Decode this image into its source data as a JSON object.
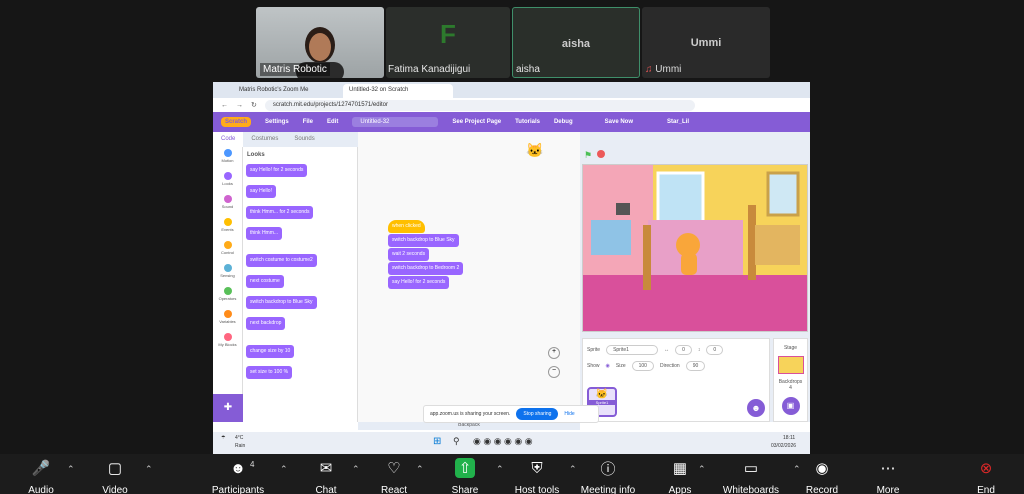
{
  "participants": [
    {
      "name": "Matris Robotic"
    },
    {
      "name": "Fatima Kanadijigui",
      "initial": "F"
    },
    {
      "name": "aisha",
      "label_large": "aisha"
    },
    {
      "name": "Ummi",
      "label_large": "Ummi"
    }
  ],
  "browser": {
    "tabs": [
      "Matris Robotic's Zoom Me",
      "Untitled-32 on Scratch"
    ],
    "url": "scratch.mit.edu/projects/1274701571/editor"
  },
  "scratch": {
    "menu": {
      "settings": "Settings",
      "file": "File",
      "edit": "Edit",
      "project_title": "Untitled-32",
      "see_project": "See Project Page",
      "tutorials": "Tutorials",
      "debug": "Debug",
      "save_now": "Save Now",
      "user": "Star_Lil"
    },
    "tabs": {
      "code": "Code",
      "costumes": "Costumes",
      "sounds": "Sounds"
    },
    "categories": [
      {
        "label": "Motion",
        "color": "#4c97ff"
      },
      {
        "label": "Looks",
        "color": "#9966ff"
      },
      {
        "label": "Sound",
        "color": "#cf63cf"
      },
      {
        "label": "Events",
        "color": "#ffbf00"
      },
      {
        "label": "Control",
        "color": "#ffab19"
      },
      {
        "label": "Sensing",
        "color": "#5cb1d6"
      },
      {
        "label": "Operators",
        "color": "#59c059"
      },
      {
        "label": "Variables",
        "color": "#ff8c1a"
      },
      {
        "label": "My Blocks",
        "color": "#ff6680"
      }
    ],
    "palette_heading": "Looks",
    "palette_blocks": [
      "say Hello! for 2 seconds",
      "say Hello!",
      "think Hmm... for 2 seconds",
      "think Hmm...",
      "switch costume to costume2",
      "next costume",
      "switch backdrop to Blue Sky",
      "next backdrop",
      "change size by 10",
      "set size to 100 %"
    ],
    "script_blocks": [
      "when clicked",
      "switch backdrop to Blue Sky",
      "wait 2 seconds",
      "switch backdrop to Bedroom 2",
      "say Hello! for 2 seconds"
    ],
    "sprite": {
      "label": "Sprite",
      "name": "Sprite1",
      "x": "0",
      "y": "0",
      "show": "Show",
      "size_label": "Size",
      "size": "100",
      "direction_label": "Direction",
      "direction": "90",
      "thumb": "Sprite1"
    },
    "stage_panel": {
      "title": "Stage",
      "backdrops_label": "Backdrops",
      "backdrops_count": "4"
    },
    "backpack": "Backpack"
  },
  "share_notice": {
    "text": "app.zoom.us is sharing your screen.",
    "stop": "Stop sharing",
    "hide": "Hide"
  },
  "taskbar": {
    "temp": "4°C",
    "weather": "Rain",
    "time": "18:11",
    "date": "03/02/2026"
  },
  "toolbar": [
    {
      "label": "Audio",
      "icon": "microphone-icon"
    },
    {
      "label": "Video",
      "icon": "video-camera-icon"
    },
    {
      "label": "Participants",
      "icon": "participants-icon",
      "count": "4"
    },
    {
      "label": "Chat",
      "icon": "chat-icon"
    },
    {
      "label": "React",
      "icon": "heart-icon"
    },
    {
      "label": "Share",
      "icon": "share-icon"
    },
    {
      "label": "Host tools",
      "icon": "shield-icon"
    },
    {
      "label": "Meeting info",
      "icon": "info-icon"
    },
    {
      "label": "Apps",
      "icon": "apps-icon"
    },
    {
      "label": "Whiteboards",
      "icon": "whiteboard-icon"
    },
    {
      "label": "Record",
      "icon": "record-icon"
    },
    {
      "label": "More",
      "icon": "more-icon"
    },
    {
      "label": "End",
      "icon": "end-icon"
    }
  ],
  "colors": {
    "scratch_purple": "#855cd6",
    "zoom_share_green": "#21b14b",
    "end_red": "#e02828"
  }
}
